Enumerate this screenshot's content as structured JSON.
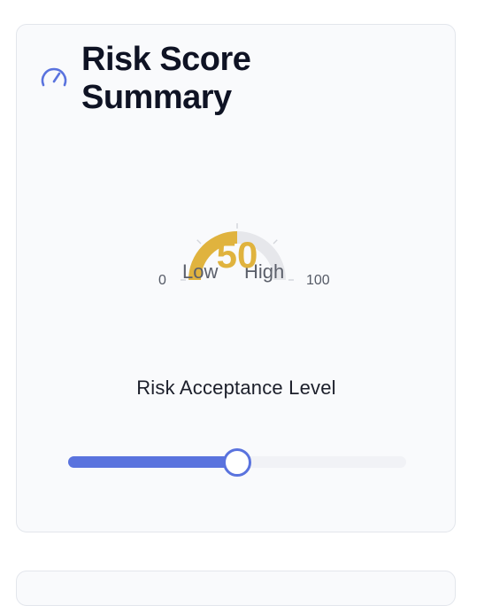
{
  "card": {
    "title": "Risk Score Summary",
    "icon": "gauge-icon",
    "accent_color": "#5a73de"
  },
  "gauge": {
    "value": 50,
    "value_text": "50",
    "min": 0,
    "max": 100,
    "min_label": "0",
    "max_label": "100",
    "low_label": "Low",
    "high_label": "High",
    "fill_color": "#e0b33e",
    "track_color": "#e6e7eb"
  },
  "slider": {
    "label": "Risk Acceptance Level",
    "value": 50,
    "min": 0,
    "max": 100,
    "fill_color": "#5a73de"
  }
}
